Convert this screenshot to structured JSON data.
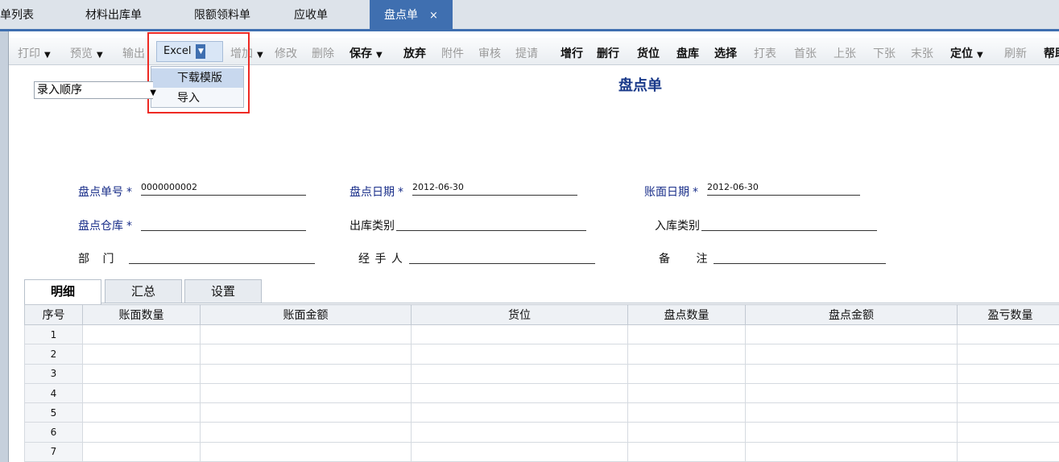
{
  "tabs": [
    {
      "label": "单列表",
      "active": false
    },
    {
      "label": "材料出库单",
      "active": false
    },
    {
      "label": "限额领料单",
      "active": false
    },
    {
      "label": "应收单",
      "active": false
    },
    {
      "label": "盘点单",
      "active": true
    }
  ],
  "active_tab_close": "×",
  "toolbar": {
    "print": "打印",
    "preview": "预览",
    "output": "输出",
    "excel": "Excel",
    "add": "增加",
    "modify": "修改",
    "delete": "删除",
    "save": "保存",
    "discard": "放弃",
    "attachment": "附件",
    "audit": "审核",
    "reminder": "提请",
    "add_row": "增行",
    "delete_row": "删行",
    "location": "货位",
    "stock": "盘库",
    "select": "选择",
    "print_table": "打表",
    "first": "首张",
    "prev": "上张",
    "next": "下张",
    "last": "末张",
    "locate": "定位",
    "refresh": "刷新",
    "help": "帮助"
  },
  "excel_menu": {
    "download_template": "下载模版",
    "import": "导入"
  },
  "sort_select": {
    "value": "录入顺序"
  },
  "document": {
    "title": "盘点单"
  },
  "form": {
    "doc_no_label": "盘点单号",
    "doc_no": "0000000002",
    "doc_date_label": "盘点日期",
    "doc_date": "2012-06-30",
    "book_date_label": "账面日期",
    "book_date": "2012-06-30",
    "warehouse_label": "盘点仓库",
    "warehouse": "",
    "out_type_label": "出库类别",
    "out_type": "",
    "in_type_label": "入库类别",
    "in_type": "",
    "dept_label": "部 门",
    "dept": "",
    "handler_label": "经 手 人",
    "handler": "",
    "remark_label": "备 注",
    "remark": "",
    "required_mark": "*"
  },
  "inner_tabs": [
    "明细",
    "汇总",
    "设置"
  ],
  "grid": {
    "columns": [
      "序号",
      "账面数量",
      "账面金额",
      "货位",
      "盘点数量",
      "盘点金额",
      "盈亏数量"
    ],
    "rows": [
      "1",
      "2",
      "3",
      "4",
      "5",
      "6",
      "7"
    ]
  },
  "colors": {
    "accent": "#3f6fb0",
    "highlight_box": "#ee2a24",
    "label_blue": "#1a2f8a"
  }
}
